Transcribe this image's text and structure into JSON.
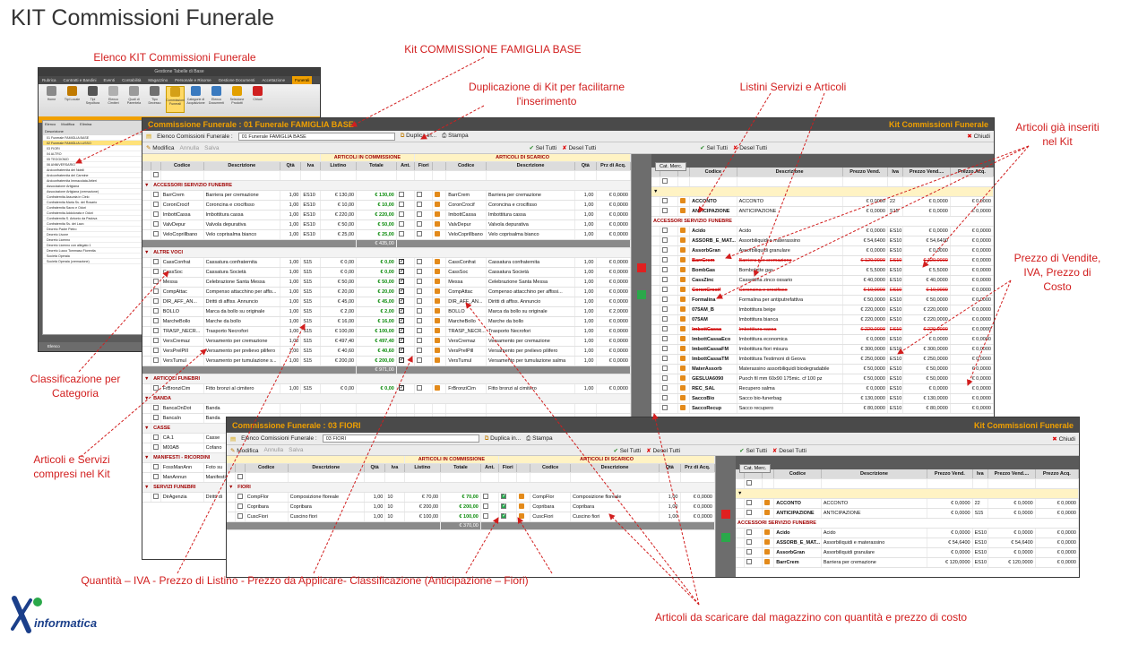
{
  "page_title": "KIT Commissioni Funerale",
  "annotations": {
    "elenco": "Elenco KIT Commissioni Funerale",
    "kit_base": "Kit COMMISSIONE  FAMIGLIA  BASE",
    "duplicazione_l1": "Duplicazione di Kit per facilitarne",
    "duplicazione_l2": "l'inserimento",
    "listini": "Listini Servizi e Articoli",
    "gia_inseriti_l1": "Articoli già inseriti",
    "gia_inseriti_l2": "nel Kit",
    "prezzo_l1": "Prezzo di Vendite,",
    "prezzo_l2": "IVA, Prezzo di",
    "prezzo_l3": "Costo",
    "classificazione_l1": "Classificazione per",
    "classificazione_l2": "Categoria",
    "articoli_servizi_l1": "Articoli e Servizi",
    "articoli_servizi_l2": "compresi nel Kit",
    "quantita": "Quantità – IVA - Prezzo di Listino  - Prezzo da Applicare- Classificazione (Anticipazione – Fiori)",
    "scaricare": "Articoli da scaricare dal magazzino con quantità e prezzo di costo"
  },
  "mini_window": {
    "title": "Gestione Tabelle di Base",
    "tabs": [
      "Rubrica",
      "Contratti e Bandini",
      "Eventi",
      "Contabilità",
      "Magazzino",
      "Personale e Risorse",
      "Gestione Documenti",
      "Accettazione",
      "Funerali"
    ],
    "active_tab": "Funerali",
    "ribbon": [
      "Home",
      "Tipi Locale",
      "Tipi Sepoltura",
      "Elenco Cimiteri",
      "Quali di Parentela",
      "Tipo Decesso",
      "Commissioni Funerali",
      "Categorie di Acquisizione",
      "Elenco Documenti",
      "Selezione Prodotti",
      "Chiudi"
    ],
    "band_label": "Gestione Commissioni Funerali",
    "toolbar": [
      "Elenco",
      "Modifica",
      "Elimina"
    ],
    "col_header": "Descrizione",
    "items": [
      "01 Funerale FAMIGLIA BASE",
      "02 Funerale FAMIGLIA LUSSO",
      "03 FIORI",
      "04 ALTRO",
      "05 TEGGIOMO",
      "06 ANNIVERSARIO",
      "Arciconfraternita dei Nobili",
      "Arciconfraternita del Carmine",
      "Arciconfraternita Immacolata Artieri",
      "Associazione Artigiana",
      "Associazione Artigiana (cremazione)",
      "Confraternita Assunta in Cielo",
      "Confraternita Maria Ss. del Rosario",
      "Confraternita Sacro e Odori",
      "Confraternita Addolorata e Odori",
      "Confraternita S. Antonio da Padova",
      "Confraternita Ss. dei Lavo",
      "Decreto Padre Pietro",
      "Decreto Livone",
      "Decreto Licenno",
      "Decreto Licenno con allegato 1",
      "Decreto Lucco Tommaso Fiorentia",
      "Società Operaia",
      "Società Operaia (cremazione)"
    ],
    "selected_item": "02 Funerale FAMIGLIA LUSSO",
    "status": "Elenco"
  },
  "win1": {
    "title": "Commissione Funerale :   01 Funerale FAMIGLIA BASE",
    "right_title": "Kit Commissioni Funerale",
    "elenco_label": "Elenco Comissioni Funerale :",
    "elenco_value": "01 Funerale FAMIGLIA BASE",
    "duplica": "Duplica in...",
    "stampa": "Stampa",
    "chiudi": "Chiudi",
    "modifica": "Modifica",
    "annulla": "Annulla",
    "salva": "Salva",
    "sel_tutti": "Sel Tutti",
    "desel_tutti": "Desel Tutti",
    "band_comm": "ARTICOLI IN COMMISSIONE",
    "band_scarico": "ARTICOLI DI SCARICO",
    "cols": [
      "Codice",
      "Descrizione",
      "Qtà",
      "Iva",
      "Listino",
      "Totale",
      "Ant.",
      "Fiori",
      "Codice",
      "Descrizione",
      "Qtà",
      "Prz di Acq."
    ],
    "sections": [
      {
        "name": "ACCESSORI SERVIZIO FUNEBRE",
        "rows": [
          [
            "BarrCrem",
            "Barriera per cremazione",
            "1,00",
            "ES10",
            "€ 130,00",
            "€ 130,00",
            "",
            "",
            "BarrCrem",
            "Barriera per cremazione",
            "1,00",
            "€ 0,0000"
          ],
          [
            "CoronCrocif",
            "Coroncina e crocifisso",
            "1,00",
            "ES10",
            "€ 10,00",
            "€ 10,00",
            "",
            "",
            "CoronCrocif",
            "Coroncina e crocifisso",
            "1,00",
            "€ 0,0000"
          ],
          [
            "ImbottCassa",
            "Imbottitura cassa",
            "1,00",
            "ES10",
            "€ 220,00",
            "€ 220,00",
            "",
            "",
            "ImbottCassa",
            "Imbottitura cassa",
            "1,00",
            "€ 0,0000"
          ],
          [
            "ValvDepur",
            "Valvola depurativa",
            "1,00",
            "ES10",
            "€ 50,00",
            "€ 50,00",
            "",
            "",
            "ValvDepur",
            "Valvola depurativa",
            "1,00",
            "€ 0,0000"
          ],
          [
            "VeloCoprillbano",
            "Velo coprisalma bianco",
            "1,00",
            "ES10",
            "€ 25,00",
            "€ 25,00",
            "",
            "",
            "VeloCoprillbano",
            "Velo coprisalma bianco",
            "1,00",
            "€ 0,0000"
          ]
        ],
        "total": "€ 435,00"
      },
      {
        "name": "ALTRE VOCI",
        "rows": [
          [
            "CassConfrat",
            "Cassatura confraternita",
            "1,00",
            "S15",
            "€ 0,00",
            "€ 0,00",
            "x",
            "",
            "CassConfrat",
            "Cassatura confraternita",
            "1,00",
            "€ 0,0000"
          ],
          [
            "CassSoc",
            "Cassatura Società",
            "1,00",
            "S15",
            "€ 0,00",
            "€ 0,00",
            "x",
            "",
            "CassSoc",
            "Cassatura Società",
            "1,00",
            "€ 0,0000"
          ],
          [
            "Messa",
            "Celebrazione Santa Messa",
            "1,00",
            "S15",
            "€ 50,00",
            "€ 50,00",
            "x",
            "",
            "Messa",
            "Celebrazione Santa Messa",
            "1,00",
            "€ 0,0000"
          ],
          [
            "CompAttac",
            "Compenso attacchino per affis...",
            "1,00",
            "S15",
            "€ 20,00",
            "€ 20,00",
            "x",
            "",
            "CompAttac",
            "Compenso attacchino per affissi...",
            "1,00",
            "€ 0,0000"
          ],
          [
            "DIR_AFF_AN...",
            "Diritti di affiss.  Annuncio",
            "1,00",
            "S15",
            "€ 45,00",
            "€ 45,00",
            "x",
            "",
            "DIR_AFF_AN...",
            "Diritti di affiss.  Annuncio",
            "1,00",
            "€ 0,0000"
          ],
          [
            "BOLLO",
            "Marca da bollo su originale",
            "1,00",
            "S15",
            "€ 2,00",
            "€ 2,00",
            "x",
            "",
            "BOLLO",
            "Marca da bollo su originale",
            "1,00",
            "€ 2,0000"
          ],
          [
            "MarcheBollo",
            "Marche da bollo",
            "1,00",
            "S15",
            "€ 16,00",
            "€ 16,00",
            "x",
            "",
            "MarcheBollo",
            "Marche da bollo",
            "1,00",
            "€ 0,0000"
          ],
          [
            "TRASP_NECR...",
            "Trasporto Necrofori",
            "1,00",
            "S15",
            "€ 100,00",
            "€ 100,00",
            "x",
            "",
            "TRASP_NECR...",
            "Trasporto Necrofori",
            "1,00",
            "€ 0,0000"
          ],
          [
            "VersCremaz",
            "Versamento per cremazione",
            "1,00",
            "S15",
            "€ 497,40",
            "€ 497,40",
            "x",
            "",
            "VersCremaz",
            "Versamento per cremazione",
            "1,00",
            "€ 0,0000"
          ],
          [
            "VersPrelPill",
            "Versamento per prelievo pilifero",
            "1,00",
            "S15",
            "€ 40,60",
            "€ 40,60",
            "x",
            "",
            "VersPrelPill",
            "Versamento per prelievo pilifero",
            "1,00",
            "€ 0,0000"
          ],
          [
            "VersTumul",
            "Versamento per tumulazione s...",
            "1,00",
            "S15",
            "€ 200,00",
            "€ 200,00",
            "x",
            "",
            "VersTumul",
            "Versamento per tumulazione salma",
            "1,00",
            "€ 0,0000"
          ]
        ],
        "total": "€ 971,00"
      },
      {
        "name": "ARTICOLI FUNEBRI",
        "rows": [
          [
            "FrBronziCim",
            "Fitto bronzi al cimitero",
            "1,00",
            "S15",
            "€ 0,00",
            "€ 0,00",
            "x",
            "",
            "FrBronziCim",
            "Fitto bronzi al cimitero",
            "1,00",
            "€ 0,0000"
          ]
        ],
        "total": ""
      },
      {
        "name": "BANDA",
        "rows": [
          [
            "BancaOnDot",
            "Banda",
            "",
            "",
            "",
            "",
            "",
            "",
            "",
            "",
            "",
            ""
          ],
          [
            "BancaIn",
            "Banda",
            "",
            "",
            "",
            "",
            "",
            "",
            "",
            "",
            "",
            ""
          ]
        ],
        "total": ""
      },
      {
        "name": "CASSE",
        "rows": [
          [
            "CA.1",
            "Casse",
            "",
            "",
            "",
            "",
            "",
            "",
            "",
            "",
            "",
            ""
          ],
          [
            "M00AB",
            "Cofano",
            "",
            "",
            "",
            "",
            "",
            "",
            "",
            "",
            "",
            ""
          ]
        ],
        "total": ""
      },
      {
        "name": "MANIFESTI - RICORDINI",
        "rows": [
          [
            "FossManAnn",
            "Foto su",
            "",
            "",
            "",
            "",
            "",
            "",
            "",
            "",
            "",
            ""
          ],
          [
            "ManAnnun",
            "Manifesti",
            "",
            "",
            "",
            "",
            "",
            "",
            "",
            "",
            "",
            ""
          ]
        ],
        "total": ""
      },
      {
        "name": "SERVIZI FUNEBRI",
        "rows": [
          [
            "DirAgenzia",
            "Diritti di",
            "",
            "",
            "",
            "",
            "",
            "",
            "",
            "",
            "",
            ""
          ]
        ],
        "total": ""
      }
    ],
    "cat_label": "Cat. Merc.",
    "right_cols": [
      "Codice",
      "Descrizione",
      "Prezzo Vend.",
      "Iva",
      "Prezzo Vend....",
      "Prezzo Acq."
    ],
    "right_rows": [
      {
        "type": "row",
        "code": "ACCONTO",
        "desc": "ACCONTO",
        "pv": "€ 0,0000",
        "iva": "22",
        "pvi": "€ 0,0000",
        "pa": "€ 0,0000",
        "strike": false
      },
      {
        "type": "row",
        "code": "ANTICIPAZIONE",
        "desc": "ANTICIPAZIONE",
        "pv": "€ 0,0000",
        "iva": "S15",
        "pvi": "€ 0,0000",
        "pa": "€ 0,0000",
        "strike": false
      },
      {
        "type": "sec",
        "name": "ACCESSORI SERVIZIO FUNEBRE"
      },
      {
        "type": "row",
        "code": "Acido",
        "desc": "Acido",
        "pv": "€ 0,0000",
        "iva": "ES10",
        "pvi": "€ 0,0000",
        "pa": "€ 0,0000",
        "strike": false
      },
      {
        "type": "row",
        "code": "ASSORB_E_MAT...",
        "desc": "Assorbiliquidi e materassino",
        "pv": "€ 54,6400",
        "iva": "ES10",
        "pvi": "€ 54,6400",
        "pa": "€ 0,0000",
        "strike": false
      },
      {
        "type": "row",
        "code": "AssorbGran",
        "desc": "Assorbiliquidi granulare",
        "pv": "€ 0,0000",
        "iva": "ES10",
        "pvi": "€ 0,0000",
        "pa": "€ 0,0000",
        "strike": false
      },
      {
        "type": "row",
        "code": "BarrCrem",
        "desc": "Barriera per cremazione",
        "pv": "€ 120,0000",
        "iva": "ES10",
        "pvi": "€ 120,0000",
        "pa": "€ 0,0000",
        "strike": true
      },
      {
        "type": "row",
        "code": "BombGas",
        "desc": "Bombolette gas",
        "pv": "€ 5,5000",
        "iva": "ES10",
        "pvi": "€ 5,5000",
        "pa": "€ 0,0000",
        "strike": false
      },
      {
        "type": "row",
        "code": "CassZinc",
        "desc": "Cassettina zinco ossario",
        "pv": "€ 40,0000",
        "iva": "ES10",
        "pvi": "€ 40,0000",
        "pa": "€ 0,0000",
        "strike": false
      },
      {
        "type": "row",
        "code": "CoronCrocif",
        "desc": "Coroncina e crocifisso",
        "pv": "€ 10,0000",
        "iva": "ES10",
        "pvi": "€ 10,0000",
        "pa": "€ 0,0000",
        "strike": true
      },
      {
        "type": "row",
        "code": "Formalina",
        "desc": "Formalina per antiputrefattiva",
        "pv": "€ 50,0000",
        "iva": "ES10",
        "pvi": "€ 50,0000",
        "pa": "€ 0,0000",
        "strike": false
      },
      {
        "type": "row",
        "code": "075AM_B",
        "desc": "Imbottitura beige",
        "pv": "€ 220,0000",
        "iva": "ES10",
        "pvi": "€ 220,0000",
        "pa": "€ 0,0000",
        "strike": false
      },
      {
        "type": "row",
        "code": "075AM",
        "desc": "Imbottitura bianca",
        "pv": "€ 220,0000",
        "iva": "ES10",
        "pvi": "€ 220,0000",
        "pa": "€ 0,0000",
        "strike": false
      },
      {
        "type": "row",
        "code": "ImbottCassa",
        "desc": "Imbottitura cassa",
        "pv": "€ 220,0000",
        "iva": "ES10",
        "pvi": "€ 220,0000",
        "pa": "€ 0,0000",
        "strike": true
      },
      {
        "type": "row",
        "code": "ImbottCassaEco",
        "desc": "Imbottitura economica",
        "pv": "€ 0,0000",
        "iva": "ES10",
        "pvi": "€ 0,0000",
        "pa": "€ 0,0000",
        "strike": false
      },
      {
        "type": "row",
        "code": "ImbottCassaFM",
        "desc": "Imbottitura fiori misura",
        "pv": "€ 300,0000",
        "iva": "ES10",
        "pvi": "€ 300,0000",
        "pa": "€ 0,0000",
        "strike": false
      },
      {
        "type": "row",
        "code": "ImbottCassaTM",
        "desc": "Imbottitura Testimoni di Geova",
        "pv": "€ 250,0000",
        "iva": "ES10",
        "pvi": "€ 250,0000",
        "pa": "€ 0,0000",
        "strike": false
      },
      {
        "type": "row",
        "code": "MaterAssorb",
        "desc": "Materassino assorbiliquidi biodegradabile",
        "pv": "€ 50,0000",
        "iva": "ES10",
        "pvi": "€ 50,0000",
        "pa": "€ 0,0000",
        "strike": false
      },
      {
        "type": "row",
        "code": "GESLUA6090",
        "desc": "Puoch fil mm 60x90 175mic. cf 100 pz",
        "pv": "€ 50,0000",
        "iva": "ES10",
        "pvi": "€ 50,0000",
        "pa": "€ 0,0000",
        "strike": false
      },
      {
        "type": "row",
        "code": "REC_SAL",
        "desc": "Recupero salma",
        "pv": "€ 0,0000",
        "iva": "ES10",
        "pvi": "€ 0,0000",
        "pa": "€ 0,0000",
        "strike": false
      },
      {
        "type": "row",
        "code": "SaccoBio",
        "desc": "Sacco bio-funerbag",
        "pv": "€ 130,0000",
        "iva": "ES10",
        "pvi": "€ 130,0000",
        "pa": "€ 0,0000",
        "strike": false
      },
      {
        "type": "row",
        "code": "SaccoRecup",
        "desc": "Sacco recupero",
        "pv": "€ 80,0000",
        "iva": "ES10",
        "pvi": "€ 80,0000",
        "pa": "€ 0,0000",
        "strike": false
      }
    ]
  },
  "win2": {
    "title": "Commissione Funerale :   03 FIORI",
    "right_title": "Kit Commissioni Funerale",
    "elenco_label": "Elenco Comissioni Funerale :",
    "elenco_value": "03 FIORI",
    "duplica": "Duplica in...",
    "stampa": "Stampa",
    "chiudi": "Chiudi",
    "modifica": "Modifica",
    "annulla": "Annulla",
    "salva": "Salva",
    "sel_tutti": "Sel Tutti",
    "desel_tutti": "Desel Tutti",
    "band_comm": "ARTICOLI IN COMMISSIONE",
    "band_scarico": "ARTICOLI DI SCARICO",
    "cols": [
      "Codice",
      "Descrizione",
      "Qtà",
      "Iva",
      "Listino",
      "Totale",
      "Ant.",
      "Fiori",
      "Codice",
      "Descrizione",
      "Qtà",
      "Prz di Acq."
    ],
    "section": "FIORI",
    "rows": [
      [
        "CompFlor",
        "Composizione floreale",
        "1,00",
        "10",
        "€ 70,00",
        "€ 70,00",
        "",
        "x",
        "CompFlor",
        "Composizione floreale",
        "1,00",
        "€ 0,0000"
      ],
      [
        "Copribara",
        "Copribara",
        "1,00",
        "10",
        "€ 200,00",
        "€ 200,00",
        "",
        "x",
        "Copribara",
        "Copribara",
        "1,00",
        "€ 0,0000"
      ],
      [
        "CuscFiori",
        "Cuscino fiori",
        "1,00",
        "10",
        "€ 100,00",
        "€ 100,00",
        "",
        "x",
        "CuscFiori",
        "Cuscino fiori",
        "1,00",
        "€ 0,0000"
      ]
    ],
    "total": "€ 370,00",
    "cat_label": "Cat. Merc.",
    "right_cols": [
      "Codice",
      "Descrizione",
      "Prezzo Vend.",
      "Iva",
      "Prezzo Vend....",
      "Prezzo Acq."
    ],
    "right_rows": [
      {
        "type": "row",
        "code": "ACCONTO",
        "desc": "ACCONTO",
        "pv": "€ 0,0000",
        "iva": "22",
        "pvi": "€ 0,0000",
        "pa": "€ 0,0000"
      },
      {
        "type": "row",
        "code": "ANTICIPAZIONE",
        "desc": "ANTICIPAZIONE",
        "pv": "€ 0,0000",
        "iva": "S15",
        "pvi": "€ 0,0000",
        "pa": "€ 0,0000"
      },
      {
        "type": "sec",
        "name": "ACCESSORI SERVIZIO FUNEBRE"
      },
      {
        "type": "row",
        "code": "Acido",
        "desc": "Acido",
        "pv": "€ 0,0000",
        "iva": "ES10",
        "pvi": "€ 0,0000",
        "pa": "€ 0,0000"
      },
      {
        "type": "row",
        "code": "ASSORB_E_MAT...",
        "desc": "Assorbiliquidi e materassino",
        "pv": "€ 54,6400",
        "iva": "ES10",
        "pvi": "€ 54,6400",
        "pa": "€ 0,0000"
      },
      {
        "type": "row",
        "code": "AssorbGran",
        "desc": "Assorbiliquidi granulare",
        "pv": "€ 0,0000",
        "iva": "ES10",
        "pvi": "€ 0,0000",
        "pa": "€ 0,0000"
      },
      {
        "type": "row",
        "code": "BarrCrem",
        "desc": "Barriera per cremazione",
        "pv": "€ 120,0000",
        "iva": "ES10",
        "pvi": "€ 120,0000",
        "pa": "€ 0,0000"
      }
    ]
  },
  "logo": {
    "letter": "X",
    "text": "informatica"
  },
  "colors": {
    "accent": "#f0a000",
    "annotation": "#d21e1e",
    "window_header": "#4a4a4a"
  }
}
